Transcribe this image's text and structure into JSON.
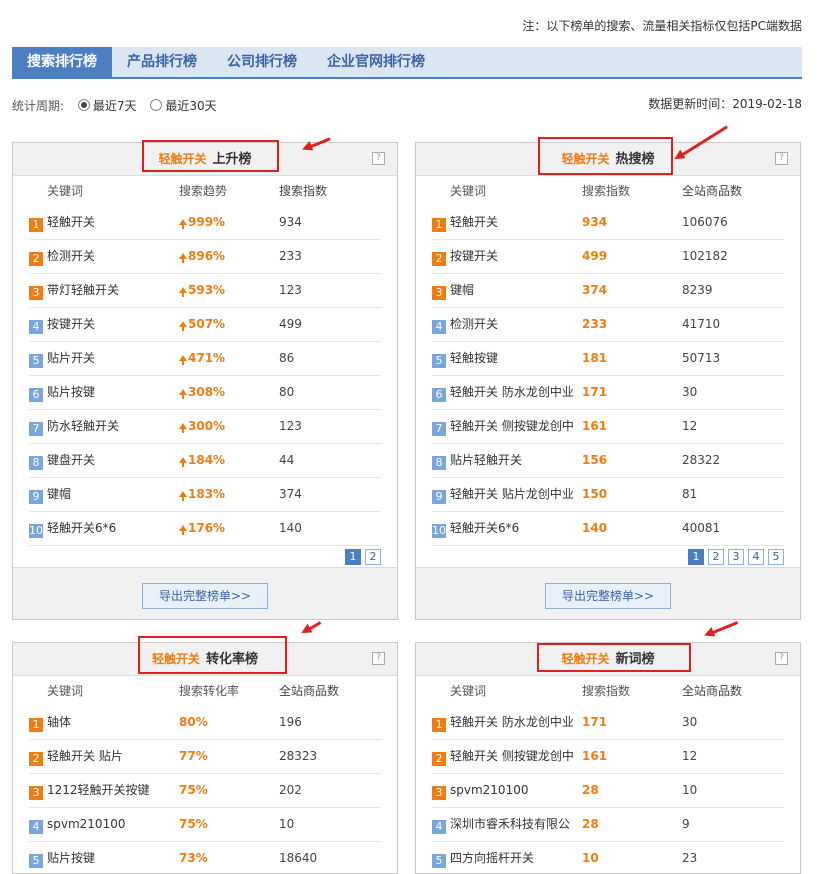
{
  "note": "注：以下榜单的搜索、流量相关指标仅包括PC端数据",
  "tabs": [
    "搜索排行榜",
    "产品排行榜",
    "公司排行榜",
    "企业官网排行榜"
  ],
  "period": {
    "label": "统计周期:",
    "options": [
      "最近7天",
      "最近30天"
    ],
    "selected": "最近7天"
  },
  "update": "数据更新时间：2019-02-18",
  "keyword": "轻触开关",
  "help": "?",
  "export_label": "导出完整榜单>>",
  "panels": [
    {
      "title": "上升榜",
      "headers": [
        "关键词",
        "搜索趋势",
        "搜索指数"
      ],
      "rows": [
        [
          "1",
          "轻触开关",
          "999%",
          "934"
        ],
        [
          "2",
          "检测开关",
          "896%",
          "233"
        ],
        [
          "3",
          "带灯轻触开关",
          "593%",
          "123"
        ],
        [
          "4",
          "按键开关",
          "507%",
          "499"
        ],
        [
          "5",
          "贴片开关",
          "471%",
          "86"
        ],
        [
          "6",
          "贴片按键",
          "308%",
          "80"
        ],
        [
          "7",
          "防水轻触开关",
          "300%",
          "123"
        ],
        [
          "8",
          "键盘开关",
          "184%",
          "44"
        ],
        [
          "9",
          "键帽",
          "183%",
          "374"
        ],
        [
          "10",
          "轻触开关6*6",
          "176%",
          "140"
        ]
      ],
      "pages": [
        "1",
        "2"
      ]
    },
    {
      "title": "热搜榜",
      "headers": [
        "关键词",
        "搜索指数",
        "全站商品数"
      ],
      "rows": [
        [
          "1",
          "轻触开关",
          "934",
          "106076"
        ],
        [
          "2",
          "按键开关",
          "499",
          "102182"
        ],
        [
          "3",
          "键帽",
          "374",
          "8239"
        ],
        [
          "4",
          "检测开关",
          "233",
          "41710"
        ],
        [
          "5",
          "轻触按键",
          "181",
          "50713"
        ],
        [
          "6",
          "轻触开关 防水龙创中业",
          "171",
          "30"
        ],
        [
          "7",
          "轻触开关 侧按键龙创中",
          "161",
          "12"
        ],
        [
          "8",
          "贴片轻触开关",
          "156",
          "28322"
        ],
        [
          "9",
          "轻触开关 贴片龙创中业",
          "150",
          "81"
        ],
        [
          "10",
          "轻触开关6*6",
          "140",
          "40081"
        ]
      ],
      "pages": [
        "1",
        "2",
        "3",
        "4",
        "5"
      ]
    },
    {
      "title": "转化率榜",
      "headers": [
        "关键词",
        "搜索转化率",
        "全站商品数"
      ],
      "rows": [
        [
          "1",
          "轴体",
          "80%",
          "196"
        ],
        [
          "2",
          "轻触开关 贴片",
          "77%",
          "28323"
        ],
        [
          "3",
          "1212轻触开关按键",
          "75%",
          "202"
        ],
        [
          "4",
          "spvm210100",
          "75%",
          "10"
        ],
        [
          "5",
          "贴片按键",
          "73%",
          "18640"
        ]
      ]
    },
    {
      "title": "新词榜",
      "headers": [
        "关键词",
        "搜索指数",
        "全站商品数"
      ],
      "rows": [
        [
          "1",
          "轻触开关 防水龙创中业",
          "171",
          "30"
        ],
        [
          "2",
          "轻触开关 侧按键龙创中",
          "161",
          "12"
        ],
        [
          "3",
          "spvm210100",
          "28",
          "10"
        ],
        [
          "4",
          "深圳市睿禾科技有限公",
          "28",
          "9"
        ],
        [
          "5",
          "四方向摇杆开关",
          "10",
          "23"
        ]
      ]
    }
  ]
}
